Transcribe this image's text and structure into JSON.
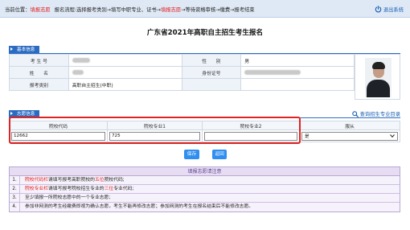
{
  "topbar": {
    "label_prefix": "当前位置：",
    "current": "填报志愿",
    "process_a": "报名流程:选择报考类别→填写中职专业、证书→",
    "process_b": "填报志愿",
    "process_c": "→等待资格审核→缴费→报考结束",
    "logout": "退出系统"
  },
  "title": "广东省2021年高职自主招生考生报名",
  "basic": {
    "tab": "基本信息",
    "exam_no_label": "考 生 号",
    "name_label": "姓　　名",
    "category_label": "报考类别",
    "category_value": "高职自主招生(中职)",
    "gender_label": "性　　别",
    "gender_value": "男",
    "id_label": "身份证号"
  },
  "wish": {
    "tab": "志愿信息",
    "query_link": "查询招生专业目录",
    "col_school_code": "院校代码",
    "col_major1": "院校专业1",
    "col_major2": "院校专业2",
    "col_obey": "服从",
    "school_code_value": "12662",
    "major1_value": "725",
    "major2_value": "",
    "obey_value": "是"
  },
  "buttons": {
    "save": "保存",
    "back": "返回"
  },
  "notes": {
    "title": "填报志愿请注意",
    "items": [
      {
        "num": "1.",
        "red": "院校代码栏",
        "mid": "请填写报考高职院校的",
        "red2": "五位",
        "tail": "院校代码;"
      },
      {
        "num": "2.",
        "red": "院校专业栏",
        "mid": "请填写报考院校招生专业的",
        "red2": "三位",
        "tail": "专业代码;"
      },
      {
        "num": "3.",
        "text": "至少填报一所院校志愿中的一个专业志愿;"
      },
      {
        "num": "4.",
        "text": "参加非网测的考生经缴费即视为确认志愿，考生不能再修改志愿；参加网测的考生在报名结束后不能修改志愿。"
      }
    ]
  },
  "colors": {
    "accent": "#2b6cc2",
    "highlight_red": "#e02323",
    "button_blue": "#2f8ef0"
  },
  "icons": {
    "logout": "power-icon",
    "query": "magnifier-icon",
    "select": "chevron-down-icon"
  }
}
